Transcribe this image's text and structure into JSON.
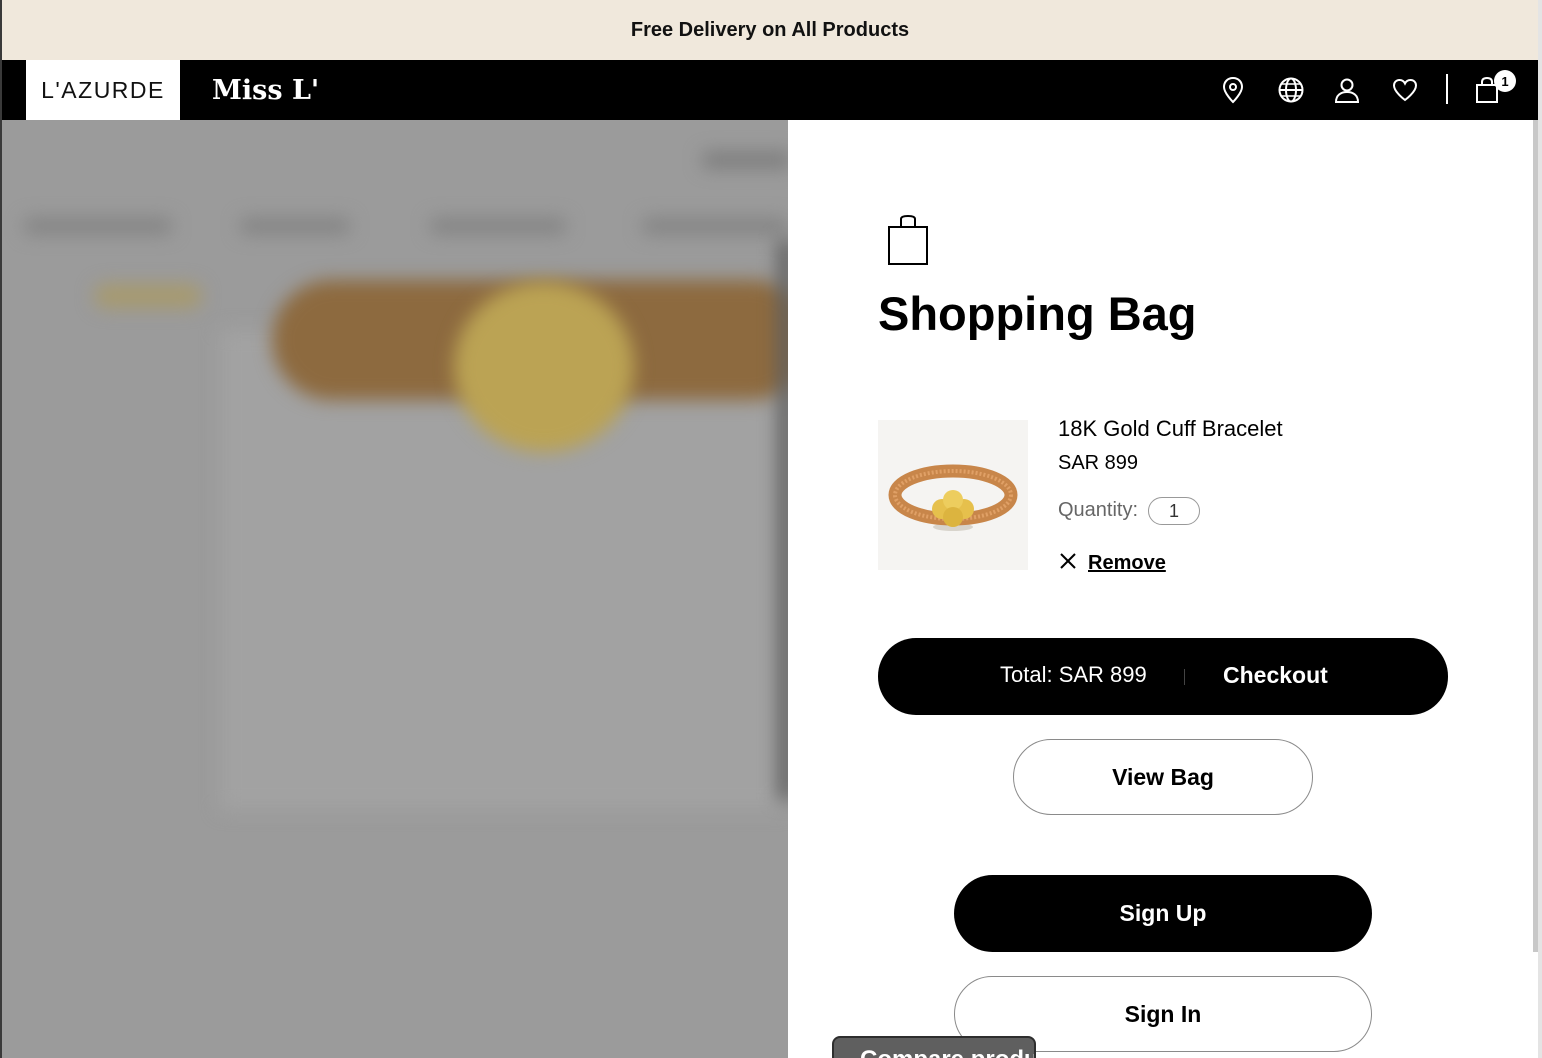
{
  "promo_bar": {
    "text": "Free Delivery on All Products"
  },
  "header": {
    "logo": "L'AZURDE",
    "sub_brand": "Miss L'",
    "icons": [
      "location-icon",
      "globe-icon",
      "user-icon",
      "heart-icon",
      "bag-icon"
    ],
    "cart_count": "1"
  },
  "drawer": {
    "title": "Shopping Bag",
    "item": {
      "name": "18K Gold Cuff Bracelet",
      "price": "SAR 899",
      "quantity_label": "Quantity:",
      "quantity": "1",
      "remove_label": "Remove"
    },
    "checkout": {
      "total_label": "Total: SAR 899",
      "button_label": "Checkout"
    },
    "view_bag_label": "View Bag",
    "sign_up_label": "Sign Up",
    "sign_in_label": "Sign In"
  },
  "bottom_tab": {
    "label": "Compare product"
  }
}
